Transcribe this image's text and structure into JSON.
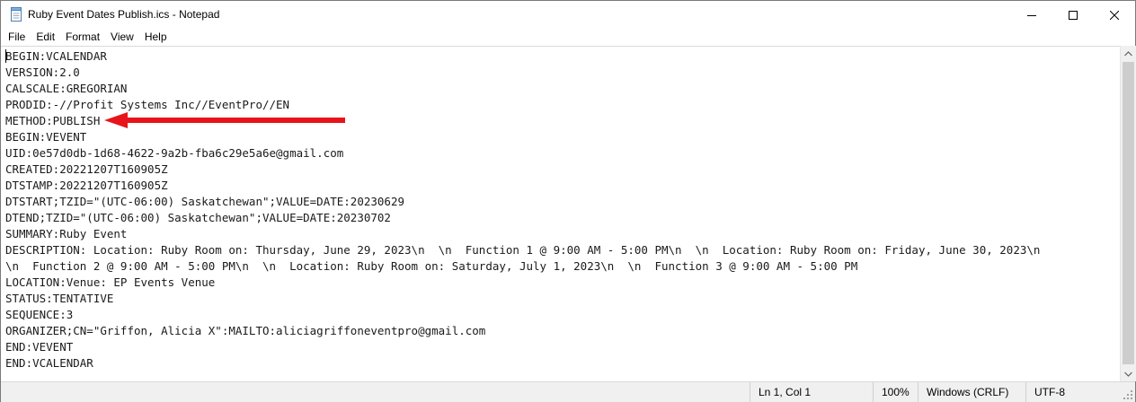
{
  "window": {
    "title": "Ruby Event Dates Publish.ics - Notepad",
    "controls": {
      "minimize_icon": "minimize-icon",
      "maximize_icon": "maximize-icon",
      "close_icon": "close-icon"
    }
  },
  "menu": {
    "items": [
      {
        "label": "File"
      },
      {
        "label": "Edit"
      },
      {
        "label": "Format"
      },
      {
        "label": "View"
      },
      {
        "label": "Help"
      }
    ]
  },
  "editor": {
    "lines": [
      "BEGIN:VCALENDAR",
      "VERSION:2.0",
      "CALSCALE:GREGORIAN",
      "PRODID:-//Profit Systems Inc//EventPro//EN",
      "METHOD:PUBLISH",
      "BEGIN:VEVENT",
      "UID:0e57d0db-1d68-4622-9a2b-fba6c29e5a6e@gmail.com",
      "CREATED:20221207T160905Z",
      "DTSTAMP:20221207T160905Z",
      "DTSTART;TZID=\"(UTC-06:00) Saskatchewan\";VALUE=DATE:20230629",
      "DTEND;TZID=\"(UTC-06:00) Saskatchewan\";VALUE=DATE:20230702",
      "SUMMARY:Ruby Event",
      "DESCRIPTION: Location: Ruby Room on: Thursday, June 29, 2023\\n  \\n  Function 1 @ 9:00 AM - 5:00 PM\\n  \\n  Location: Ruby Room on: Friday, June 30, 2023\\n",
      "\\n  Function 2 @ 9:00 AM - 5:00 PM\\n  \\n  Location: Ruby Room on: Saturday, July 1, 2023\\n  \\n  Function 3 @ 9:00 AM - 5:00 PM",
      "LOCATION:Venue: EP Events Venue",
      "STATUS:TENTATIVE",
      "SEQUENCE:3",
      "ORGANIZER;CN=\"Griffon, Alicia X\":MAILTO:aliciagriffoneventpro@gmail.com",
      "END:VEVENT",
      "END:VCALENDAR"
    ],
    "annotation": {
      "icon": "red-arrow-icon",
      "color": "#e8141b"
    }
  },
  "status": {
    "position": "Ln 1, Col 1",
    "zoom": "100%",
    "line_endings": "Windows (CRLF)",
    "encoding": "UTF-8"
  }
}
